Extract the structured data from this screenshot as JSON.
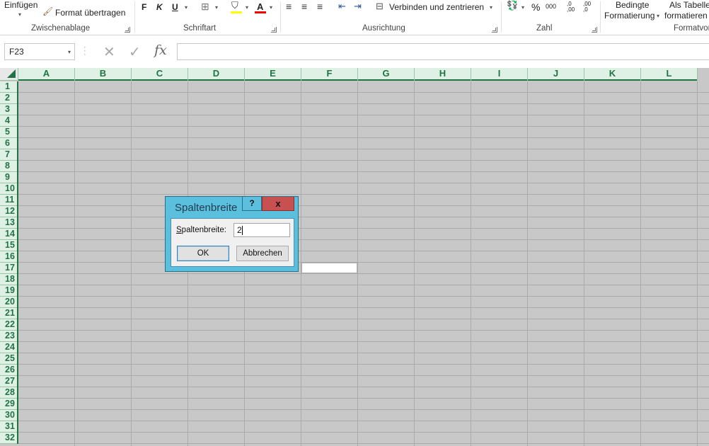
{
  "ribbon": {
    "clipboard": {
      "paste_label": "Einfügen",
      "format_painter_label": "Format übertragen",
      "group_label": "Zwischenablage"
    },
    "font": {
      "bold": "F",
      "italic": "K",
      "underline": "U",
      "group_label": "Schriftart",
      "fill_color": "#ffff00",
      "font_color": "#ff0000"
    },
    "alignment": {
      "merge_label": "Verbinden und zentrieren",
      "group_label": "Ausrichtung"
    },
    "number": {
      "percent": "%",
      "thousands": "000",
      "increase_decimal": ",0 ,00",
      "decrease_decimal": ",00 ,0",
      "group_label": "Zahl"
    },
    "styles": {
      "conditional_line1": "Bedingte",
      "conditional_line2": "Formatierung",
      "table_line1": "Als Tabelle",
      "table_line2": "formatieren",
      "group_label": "Formatvor"
    }
  },
  "formula_bar": {
    "name_box": "F23",
    "fx_label": "fx",
    "formula": ""
  },
  "sheet": {
    "columns": [
      "A",
      "B",
      "C",
      "D",
      "E",
      "F",
      "G",
      "H",
      "I",
      "J",
      "K",
      "L"
    ],
    "rows": [
      "1",
      "2",
      "3",
      "4",
      "5",
      "6",
      "7",
      "8",
      "9",
      "10",
      "11",
      "12",
      "13",
      "14",
      "15",
      "16",
      "17",
      "18",
      "19",
      "20",
      "21",
      "22",
      "23",
      "24",
      "25",
      "26",
      "27",
      "28",
      "29",
      "30",
      "31",
      "32"
    ],
    "active_cell": "F23"
  },
  "dialog": {
    "title": "Spaltenbreite",
    "help": "?",
    "close": "x",
    "field_label_first": "S",
    "field_label_rest": "paltenbreite:",
    "value": "2",
    "ok_label": "OK",
    "cancel_label": "Abbrechen"
  },
  "colors": {
    "accent": "#217346",
    "dialog_frame": "#5bc0de",
    "close_button": "#c75050"
  }
}
